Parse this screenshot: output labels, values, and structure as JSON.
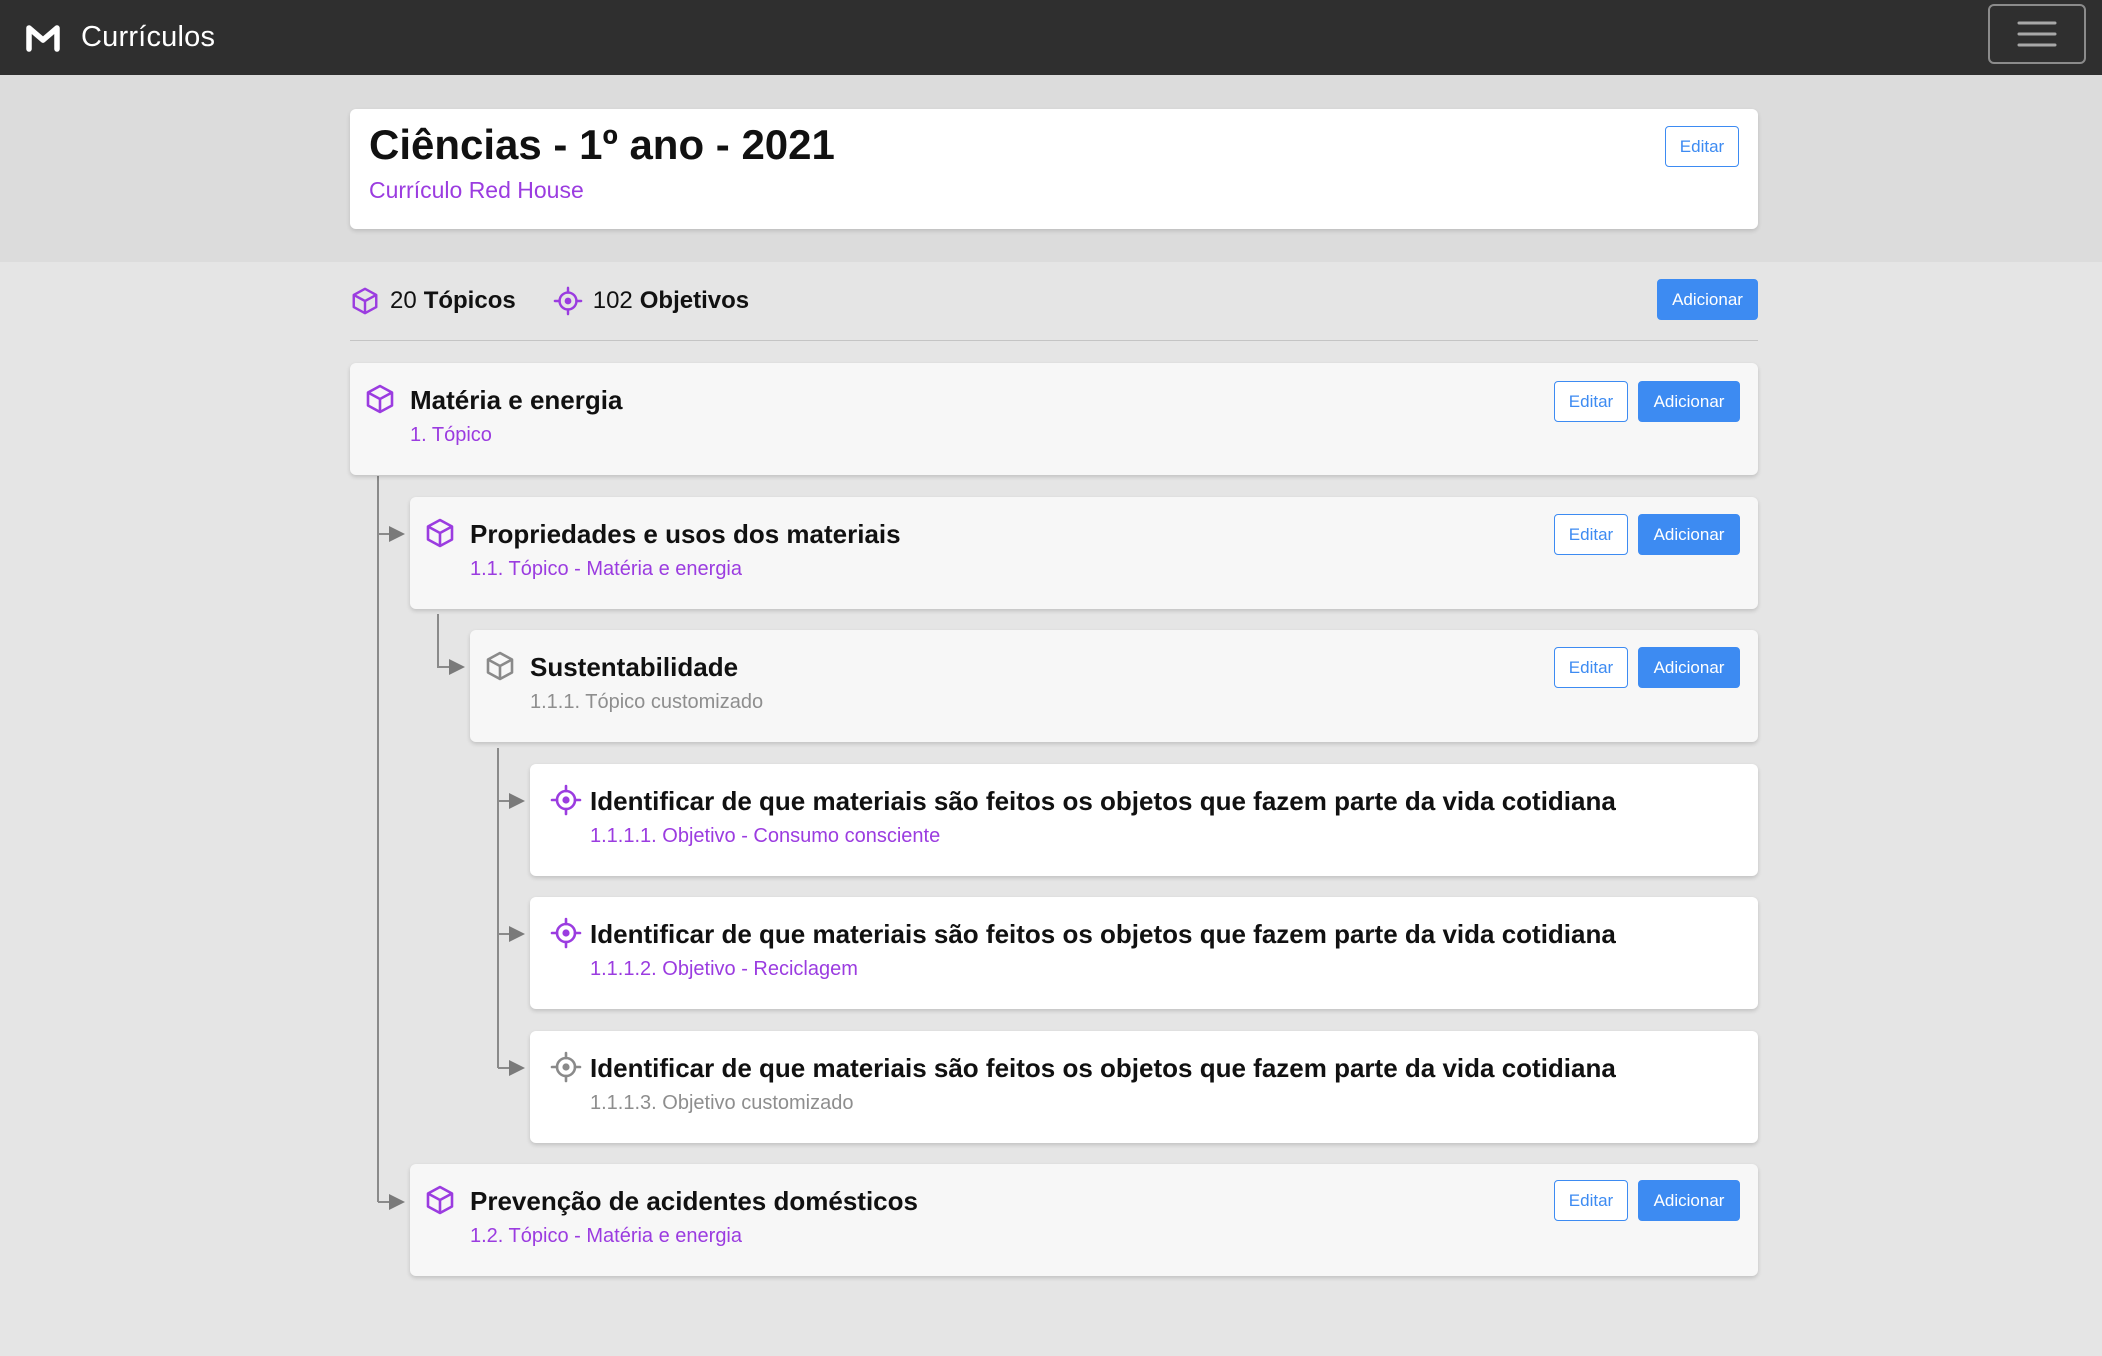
{
  "navbar": {
    "title": "Currículos",
    "logo_icon": "m-logo-icon",
    "menu_icon": "hamburger-icon"
  },
  "header": {
    "title": "Ciências - 1º ano - 2021",
    "subtitle": "Currículo Red House",
    "edit_label": "Editar"
  },
  "stats": {
    "topics_count": "20",
    "topics_label": "Tópicos",
    "objectives_count": "102",
    "objectives_label": "Objetivos",
    "add_label": "Adicionar"
  },
  "tree": [
    {
      "title": "Matéria e energia",
      "subtitle": "1. Tópico",
      "kind": "topic",
      "custom": false,
      "edit_label": "Editar",
      "add_label": "Adicionar"
    },
    {
      "title": "Propriedades e usos dos materiais",
      "subtitle": "1.1. Tópico - Matéria e energia",
      "kind": "topic",
      "custom": false,
      "edit_label": "Editar",
      "add_label": "Adicionar"
    },
    {
      "title": "Sustentabilidade",
      "subtitle": "1.1.1. Tópico customizado",
      "kind": "topic",
      "custom": true,
      "edit_label": "Editar",
      "add_label": "Adicionar"
    },
    {
      "title": "Identificar de que materiais são feitos os objetos que fazem parte da vida cotidiana",
      "subtitle": "1.1.1.1. Objetivo - Consumo consciente",
      "kind": "objective",
      "custom": false
    },
    {
      "title": "Identificar de que materiais são feitos os objetos que fazem parte da vida cotidiana",
      "subtitle": "1.1.1.2. Objetivo - Reciclagem",
      "kind": "objective",
      "custom": false
    },
    {
      "title": "Identificar de que materiais são feitos os objetos que fazem parte da vida cotidiana",
      "subtitle": "1.1.1.3. Objetivo customizado",
      "kind": "objective",
      "custom": true
    },
    {
      "title": "Prevenção de acidentes domésticos",
      "subtitle": "1.2. Tópico - Matéria e energia",
      "kind": "topic",
      "custom": false,
      "edit_label": "Editar",
      "add_label": "Adicionar"
    }
  ],
  "colors": {
    "navbar_bg": "#2f2f2f",
    "accent_purple": "#9b3ce0",
    "primary_blue": "#3d8bf2",
    "muted_gray": "#8e8e8e"
  }
}
